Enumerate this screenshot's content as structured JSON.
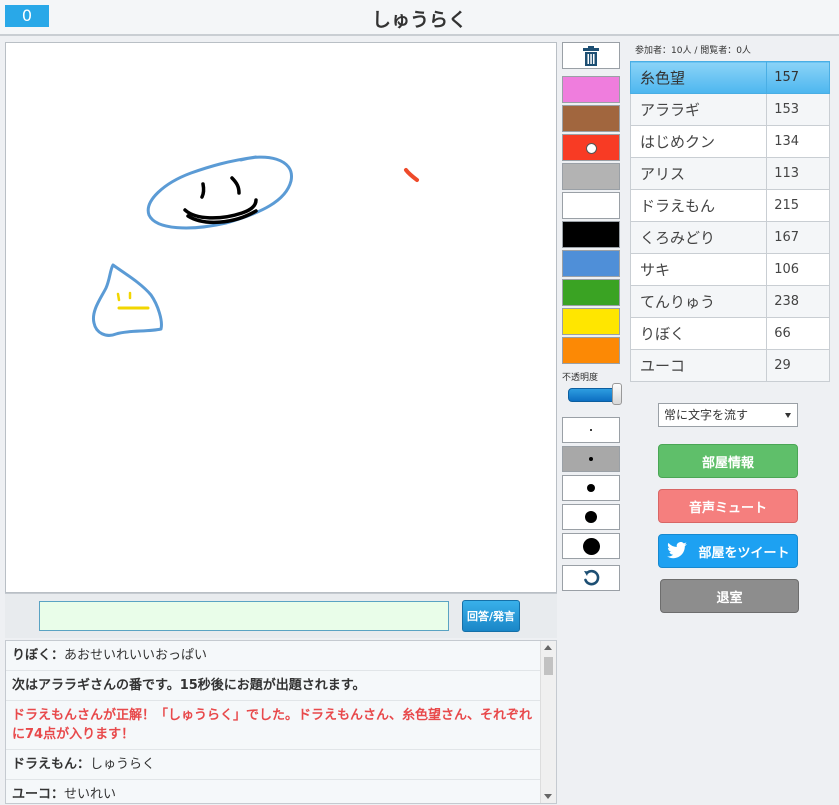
{
  "header": {
    "timer": "0",
    "title": "しゅうらく"
  },
  "colors": {
    "accent": "#29a8e8",
    "palette": [
      "#ef7ddd",
      "#a1663e",
      "#f83b24",
      "#b3b3b3",
      "#ffffff",
      "#000000",
      "#4f8fd8",
      "#3aa323",
      "#ffe600",
      "#fc8905"
    ],
    "selected_palette_index": 2,
    "drawing_blue": "#5b9bd5",
    "drawing_yellow": "#f2d600",
    "drawing_red": "#ee4a2a",
    "drawing_black": "#000000"
  },
  "tools": {
    "trash_icon": "trash-icon",
    "opacity_label": "不透明度",
    "opacity_value": 1.0,
    "brush_sizes": [
      1,
      2,
      3,
      4,
      5
    ],
    "selected_size_index": 1,
    "undo_icon": "undo-icon"
  },
  "participants": {
    "summary": "参加者：10人 / 閲覧者：0人",
    "players": [
      {
        "name": "糸色望",
        "score": "157"
      },
      {
        "name": "アララギ",
        "score": "153"
      },
      {
        "name": "はじめクン",
        "score": "134"
      },
      {
        "name": "アリス",
        "score": "113"
      },
      {
        "name": "ドラえもん",
        "score": "215"
      },
      {
        "name": "くろみどり",
        "score": "167"
      },
      {
        "name": "サキ",
        "score": "106"
      },
      {
        "name": "てんりゅう",
        "score": "238"
      },
      {
        "name": "りぼく",
        "score": "66"
      },
      {
        "name": "ユーコ",
        "score": "29"
      }
    ],
    "current_player_index": 0
  },
  "controls": {
    "flow_select_value": "常に文字を流す",
    "room_info_label": "部屋情報",
    "mute_label": "音声ミュート",
    "tweet_label": "部屋をツイート",
    "exit_label": "退室"
  },
  "answer": {
    "input_value": "",
    "button_label": "回答/発言"
  },
  "chat": [
    {
      "type": "message",
      "name": "りぼく",
      "sep": "：",
      "text": "あおせいれいいおっぱい"
    },
    {
      "type": "system",
      "text": "次はアララギさんの番です。15秒後にお題が出題されます。"
    },
    {
      "type": "correct",
      "text": "ドラえもんさんが正解！「しゅうらく」でした。ドラえもんさん、糸色望さん、それぞれに74点が入ります！"
    },
    {
      "type": "message",
      "name": "ドラえもん",
      "sep": "：",
      "text": "しゅうらく"
    },
    {
      "type": "message",
      "name": "ユーコ",
      "sep": "：",
      "text": "せいれい"
    }
  ]
}
